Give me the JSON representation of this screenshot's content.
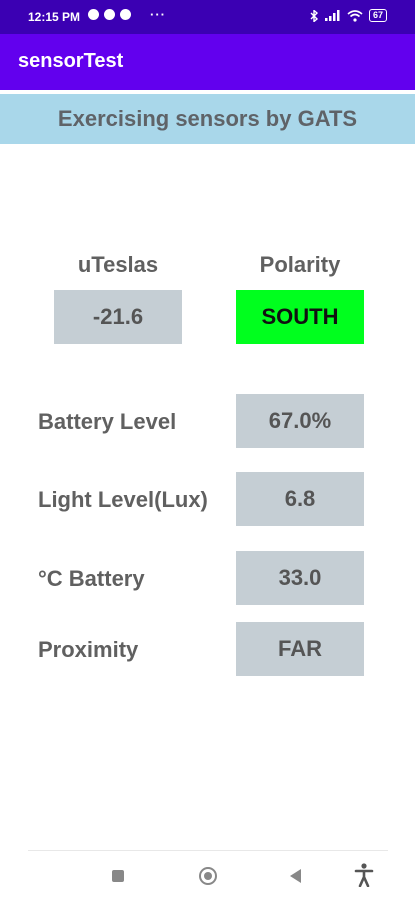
{
  "status_bar": {
    "time": "12:15 PM",
    "battery": "67",
    "more_indicator": "···"
  },
  "app_bar": {
    "title": "sensorTest"
  },
  "banner": {
    "text": "Exercising sensors by GATS"
  },
  "magnet": {
    "utesla_label": "uTeslas",
    "utesla_value": "-21.6",
    "polarity_label": "Polarity",
    "polarity_value": "SOUTH"
  },
  "readings": [
    {
      "label": "Battery Level",
      "value": "67.0%"
    },
    {
      "label": "Light Level(Lux)",
      "value": "6.8"
    },
    {
      "label": "°C Battery",
      "value": "33.0"
    },
    {
      "label": "Proximity",
      "value": "FAR"
    }
  ],
  "colors": {
    "status_bar": "#3b00b3",
    "app_bar": "#6200ee",
    "banner": "#a9d7ea",
    "value_box": "#c5ced4",
    "polarity_highlight": "#00ff1e"
  }
}
